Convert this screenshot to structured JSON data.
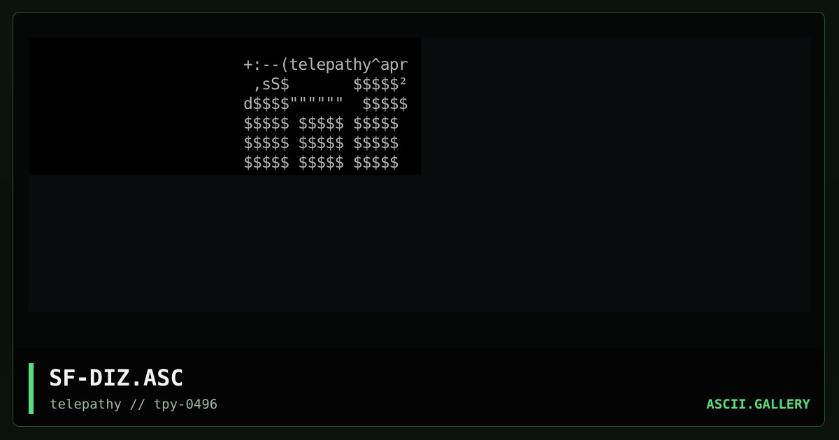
{
  "artwork": {
    "lines": "+:--(telepathy^apr\n ,sS$       $$$$$²\nd$$$$\"\"\"\"\"\"  $$$$$\n$$$$$ $$$$$ $$$$$\n$$$$$ $$$$$ $$$$$\n$$$$$ $$$$$ $$$$$"
  },
  "footer": {
    "title": "SF-DIZ.ASC",
    "subtitle": "telepathy // tpy-0496",
    "brand": "ASCII.GALLERY"
  },
  "colors": {
    "accent": "#55e07a",
    "frame_border": "#1f5a33",
    "art_text": "#b4b4b4"
  }
}
